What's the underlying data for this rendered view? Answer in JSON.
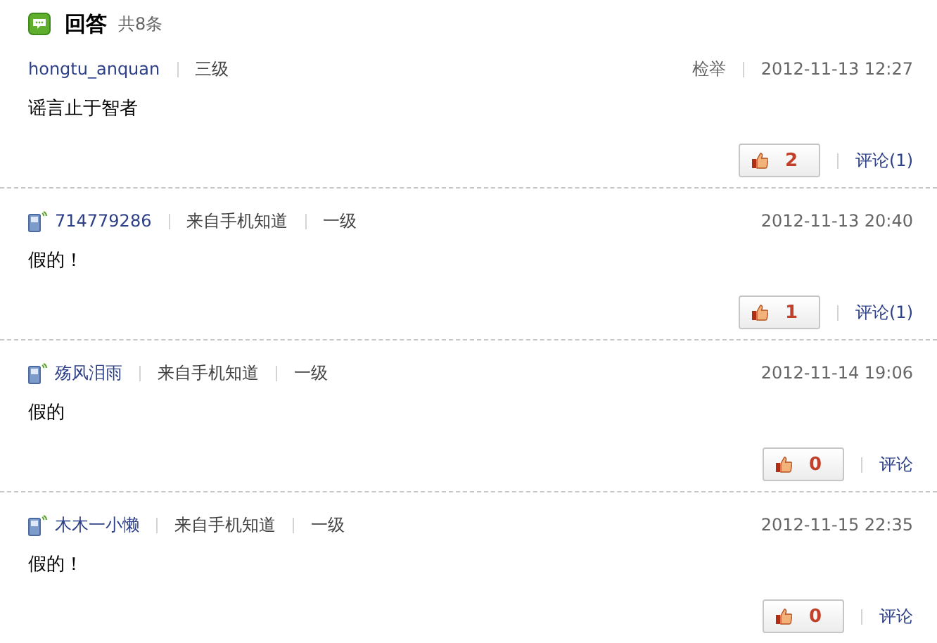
{
  "header": {
    "title": "回答",
    "count": "共8条"
  },
  "answers": [
    {
      "mobile": false,
      "user": "hongtu_anquan",
      "level": "三级",
      "report": "检举",
      "time": "2012-11-13 12:27",
      "text": "谣言止于智者",
      "likes": "2",
      "comment": "评论(1)"
    },
    {
      "mobile": true,
      "user": "714779286",
      "source": "来自手机知道",
      "level": "一级",
      "time": "2012-11-13 20:40",
      "text": "假的！",
      "likes": "1",
      "comment": "评论(1)"
    },
    {
      "mobile": true,
      "user": "殇风泪雨",
      "source": "来自手机知道",
      "level": "一级",
      "time": "2012-11-14 19:06",
      "text": "假的",
      "likes": "0",
      "comment": "评论"
    },
    {
      "mobile": true,
      "user": "木木一小懒",
      "source": "来自手机知道",
      "level": "一级",
      "time": "2012-11-15 22:35",
      "text": "假的！",
      "likes": "0",
      "comment": "评论"
    }
  ]
}
